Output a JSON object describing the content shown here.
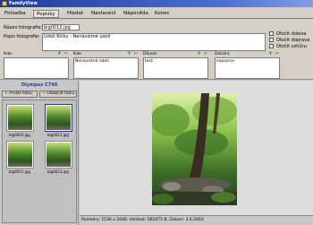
{
  "window": {
    "title": "FamilyView"
  },
  "menu": [
    "Fotoalba",
    "Popisky",
    "Hledat",
    "Nastavení",
    "Nápověda",
    "Konec"
  ],
  "form": {
    "filename_label": "Název fotografie:",
    "filename_value": "big0012.jpg",
    "description_label": "Popis fotografie:",
    "description_value": "Údolí Říčky - Nenávistné údolí",
    "options": [
      "Otočit doleva",
      "Otočit doprava",
      "Otočit vzhůru"
    ],
    "panels": [
      {
        "label": "Kdo:",
        "items": []
      },
      {
        "label": "Kde:",
        "items": [
          "Nenávistné údolí"
        ]
      },
      {
        "label": "Důvod:",
        "items": [
          "test"
        ]
      },
      {
        "label": "Datalní:",
        "items": [
          "expozice"
        ]
      }
    ]
  },
  "camera": {
    "title": "Olympus C740",
    "add_label": "Přidat fotku",
    "remove_label": "Odebrat fotku"
  },
  "thumbnails": [
    "big0010.jpg",
    "big0012.jpg",
    "big0015.jpg",
    "big0023.jpg"
  ],
  "status": "Rozměry: 1536 x 2048, Velikost: 681075 B, Datum: 3.6.2003",
  "colors": {
    "titlebar": "#1c3d9a",
    "plus": "#1a8a1a",
    "minus": "#c01010",
    "camera_title": "#2a3a9a"
  }
}
